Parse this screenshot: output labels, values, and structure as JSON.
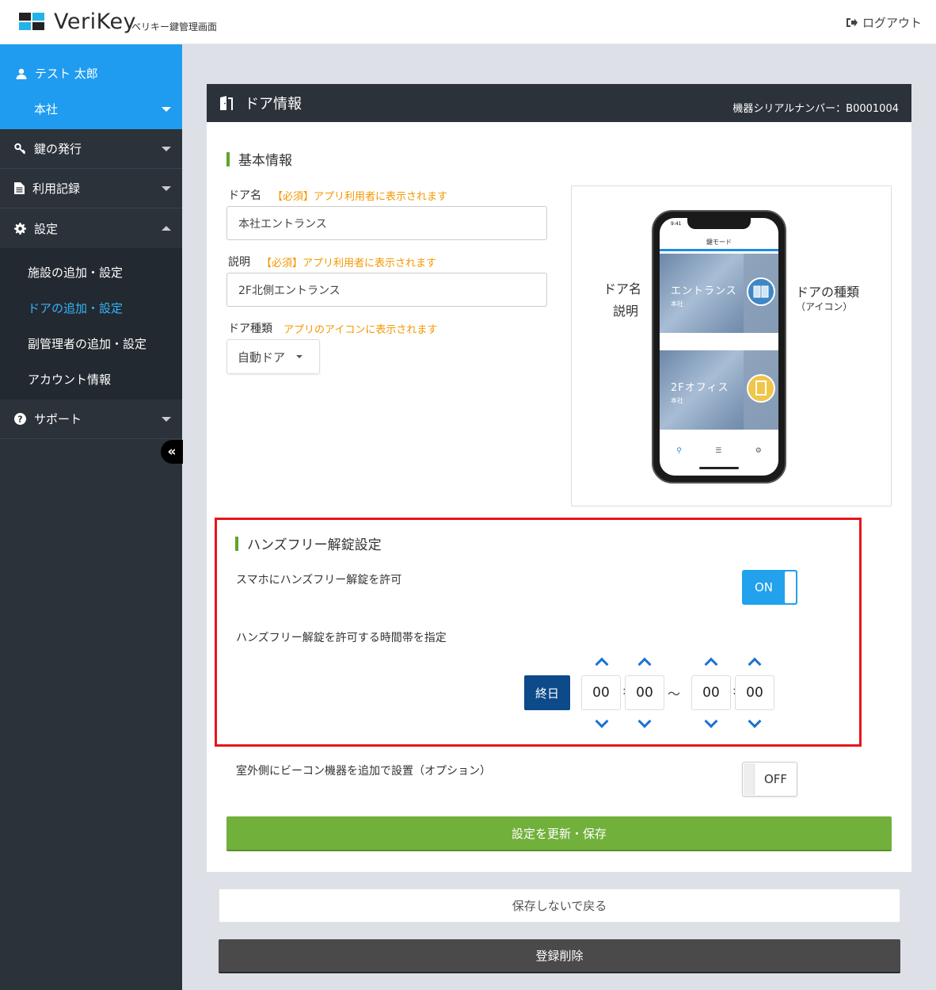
{
  "brand": {
    "name": "VeriKey",
    "subtitle": "ベリキー鍵管理画面",
    "colors": {
      "accent": "#1f9cf0",
      "dark": "#2c323a",
      "green": "#72b03c",
      "red": "#e8141b"
    }
  },
  "header": {
    "logout": "ログアウト",
    "logout_icon": "sign-out-icon"
  },
  "sidebar": {
    "user_name": "テスト 太郎",
    "org": "本社",
    "menu": [
      {
        "label": "鍵の発行",
        "icon": "key-icon"
      },
      {
        "label": "利用記録",
        "icon": "document-icon"
      },
      {
        "label": "設定",
        "icon": "gear-icon"
      }
    ],
    "submenu": [
      "施設の追加・設定",
      "ドアの追加・設定",
      "副管理者の追加・設定",
      "アカウント情報"
    ],
    "active_sub": "ドアの追加・設定",
    "support": "サポート",
    "collapse": "«"
  },
  "card": {
    "title": "ドア情報",
    "serial": "機器シリアルナンバー：B0001004",
    "basic": {
      "title": "基本情報",
      "door_name_label": "ドア名",
      "door_name_note": "【必須】アプリ利用者に表示されます",
      "door_name_value": "本社エントランス",
      "desc_label": "説明",
      "desc_note": "【必須】アプリ利用者に表示されます",
      "desc_value": "2F北側エントランス",
      "type_label": "ドア種類",
      "type_note": "アプリのアイコンに表示されます",
      "type_value": "自動ドア"
    },
    "preview": {
      "left_label_1": "ドア名",
      "left_label_2": "説明",
      "right_label_1": "ドアの種類",
      "right_label_2": "（アイコン）",
      "phone_time": "9:41",
      "phone_title": "鍵モード",
      "tiles": [
        {
          "name": "エントランス",
          "sub": "本社",
          "icon": "automatic-door-icon"
        },
        {
          "name": "2Fオフィス",
          "sub": "本社",
          "icon": "door-icon"
        }
      ]
    },
    "handsfree": {
      "title": "ハンズフリー解錠設定",
      "allow_label": "スマホにハンズフリー解錠を許可",
      "allow_state": "ON",
      "time_label": "ハンズフリー解錠を許可する時間帯を指定",
      "all_day": "終日",
      "start_h": "00",
      "start_m": "00",
      "end_h": "00",
      "end_m": "00",
      "tilde": "〜",
      "colon": ":"
    },
    "beacon": {
      "label": "室外側にビーコン機器を追加で設置（オプション）",
      "state": "OFF"
    },
    "save": "設定を更新・保存"
  },
  "back": "保存しないで戻る",
  "delete": "登録削除"
}
